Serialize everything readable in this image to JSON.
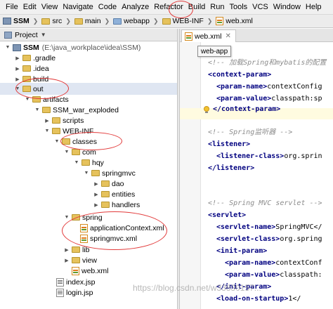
{
  "menu": [
    "File",
    "Edit",
    "View",
    "Navigate",
    "Code",
    "Analyze",
    "Refactor",
    "Build",
    "Run",
    "Tools",
    "VCS",
    "Window",
    "Help"
  ],
  "breadcrumbs": [
    "SSM",
    "src",
    "main",
    "webapp",
    "WEB-INF",
    "web.xml"
  ],
  "project_panel": {
    "title": "Project",
    "tree": [
      {
        "label": "SSM",
        "path": "(E:\\java_workplace\\idea\\SSM)",
        "icon": "module-icon",
        "expanded": true
      },
      {
        "label": ".gradle",
        "icon": "folder-icon",
        "expanded": false
      },
      {
        "label": ".idea",
        "icon": "folder-icon",
        "expanded": false
      },
      {
        "label": "build",
        "icon": "folder-icon",
        "expanded": false
      },
      {
        "label": "out",
        "icon": "folder-icon",
        "expanded": true
      },
      {
        "label": "artifacts",
        "icon": "folder-icon",
        "expanded": true
      },
      {
        "label": "SSM_war_exploded",
        "icon": "folder-icon",
        "expanded": true
      },
      {
        "label": "scripts",
        "icon": "folder-icon",
        "expanded": false
      },
      {
        "label": "WEB-INF",
        "icon": "folder-icon",
        "expanded": true
      },
      {
        "label": "classes",
        "icon": "folder-icon",
        "expanded": true
      },
      {
        "label": "com",
        "icon": "folder-icon",
        "expanded": true
      },
      {
        "label": "hqy",
        "icon": "folder-icon",
        "expanded": true
      },
      {
        "label": "springmvc",
        "icon": "folder-icon",
        "expanded": true
      },
      {
        "label": "dao",
        "icon": "folder-icon",
        "expanded": false
      },
      {
        "label": "entities",
        "icon": "folder-icon",
        "expanded": false
      },
      {
        "label": "handlers",
        "icon": "folder-icon",
        "expanded": false
      },
      {
        "label": "spring",
        "icon": "folder-icon",
        "expanded": true
      },
      {
        "label": "applicationContext.xml",
        "icon": "xml-file-icon"
      },
      {
        "label": "springmvc.xml",
        "icon": "xml-file-icon"
      },
      {
        "label": "lib",
        "icon": "folder-icon",
        "expanded": false
      },
      {
        "label": "view",
        "icon": "folder-icon",
        "expanded": false
      },
      {
        "label": "web.xml",
        "icon": "xml-file-icon"
      },
      {
        "label": "index.jsp",
        "icon": "jsp-file-icon"
      },
      {
        "label": "login.jsp",
        "icon": "jsp-file-icon"
      }
    ]
  },
  "editor": {
    "tab_label": "web.xml",
    "tooltip": "web-app",
    "lines": [
      {
        "kind": "comment",
        "text": "<!-- 加载Spring和mybatis的配置"
      },
      {
        "kind": "tag",
        "text": "<context-param>"
      },
      {
        "kind": "tag",
        "text": "<param-name>",
        "rest": "contextConfig"
      },
      {
        "kind": "tag",
        "text": "<param-value>",
        "rest": "classpath:sp"
      },
      {
        "kind": "tag",
        "text": "</context-param>"
      },
      {
        "kind": "comment",
        "text": "<!-- Spring监听器 -->"
      },
      {
        "kind": "tag",
        "text": "<listener>"
      },
      {
        "kind": "tag",
        "text": "<listener-class>",
        "rest": "org.sprin"
      },
      {
        "kind": "tag",
        "text": "</listener>"
      },
      {
        "kind": "comment",
        "text": "<!-- Spring MVC servlet -->"
      },
      {
        "kind": "tag",
        "text": "<servlet>"
      },
      {
        "kind": "tag",
        "text": "<servlet-name>",
        "rest": "SpringMVC</"
      },
      {
        "kind": "tag",
        "text": "<servlet-class>",
        "rest": "org.spring"
      },
      {
        "kind": "tag",
        "text": "<init-param>"
      },
      {
        "kind": "tag",
        "text": "<param-name>",
        "rest": "contextConf"
      },
      {
        "kind": "tag",
        "text": "<param-value>",
        "rest": "classpath:"
      },
      {
        "kind": "tag",
        "text": "</init-param>"
      },
      {
        "kind": "tag",
        "text": "<load-on-startup>",
        "rest": "1</"
      }
    ]
  },
  "watermark": "https://blog.csdn.net/w33830157...",
  "colors": {
    "annotation": "#e23a3a",
    "tag": "#000080",
    "comment": "#8c8c8c",
    "selection": "#dfe6f2"
  }
}
